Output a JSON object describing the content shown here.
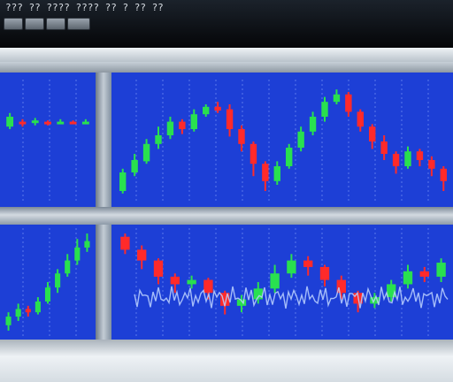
{
  "window": {
    "title": "??? ?? ???? ???? ?? ? ?? ??"
  },
  "toolbar": {
    "buttons": [
      {
        "icon": "button-icon"
      },
      {
        "icon": "button-icon"
      },
      {
        "icon": "button-icon"
      },
      {
        "icon": "button-icon"
      }
    ]
  },
  "theme": {
    "chart_bg": "#1d3fd6",
    "grid": "#8fa7ff",
    "bull": "#29e04f",
    "bear": "#ff2a2a",
    "noise": "#bcd2ff"
  },
  "chart_data": [
    {
      "type": "candlestick",
      "panel": "top-left",
      "series": [
        {
          "candles": [
            {
              "o": 0.62,
              "c": 0.7,
              "h": 0.73,
              "l": 0.6
            },
            {
              "o": 0.66,
              "c": 0.64,
              "h": 0.68,
              "l": 0.62
            },
            {
              "o": 0.65,
              "c": 0.67,
              "h": 0.69,
              "l": 0.63
            },
            {
              "o": 0.66,
              "c": 0.65,
              "h": 0.67,
              "l": 0.63
            },
            {
              "o": 0.65,
              "c": 0.66,
              "h": 0.68,
              "l": 0.64
            },
            {
              "o": 0.66,
              "c": 0.65,
              "h": 0.67,
              "l": 0.64
            },
            {
              "o": 0.65,
              "c": 0.66,
              "h": 0.68,
              "l": 0.64
            }
          ]
        }
      ]
    },
    {
      "type": "candlestick",
      "panel": "top-right",
      "series": [
        {
          "candles": [
            {
              "o": 0.1,
              "c": 0.25,
              "h": 0.28,
              "l": 0.08
            },
            {
              "o": 0.25,
              "c": 0.35,
              "h": 0.4,
              "l": 0.22
            },
            {
              "o": 0.34,
              "c": 0.48,
              "h": 0.52,
              "l": 0.32
            },
            {
              "o": 0.48,
              "c": 0.55,
              "h": 0.62,
              "l": 0.44
            },
            {
              "o": 0.55,
              "c": 0.66,
              "h": 0.7,
              "l": 0.52
            },
            {
              "o": 0.66,
              "c": 0.6,
              "h": 0.68,
              "l": 0.56
            },
            {
              "o": 0.6,
              "c": 0.72,
              "h": 0.76,
              "l": 0.58
            },
            {
              "o": 0.72,
              "c": 0.78,
              "h": 0.8,
              "l": 0.7
            },
            {
              "o": 0.78,
              "c": 0.75,
              "h": 0.82,
              "l": 0.73
            },
            {
              "o": 0.76,
              "c": 0.6,
              "h": 0.8,
              "l": 0.54
            },
            {
              "o": 0.6,
              "c": 0.48,
              "h": 0.63,
              "l": 0.42
            },
            {
              "o": 0.48,
              "c": 0.32,
              "h": 0.5,
              "l": 0.22
            },
            {
              "o": 0.32,
              "c": 0.18,
              "h": 0.34,
              "l": 0.1
            },
            {
              "o": 0.18,
              "c": 0.3,
              "h": 0.34,
              "l": 0.15
            },
            {
              "o": 0.3,
              "c": 0.45,
              "h": 0.48,
              "l": 0.28
            },
            {
              "o": 0.45,
              "c": 0.58,
              "h": 0.62,
              "l": 0.42
            },
            {
              "o": 0.58,
              "c": 0.7,
              "h": 0.74,
              "l": 0.55
            },
            {
              "o": 0.7,
              "c": 0.82,
              "h": 0.86,
              "l": 0.66
            },
            {
              "o": 0.82,
              "c": 0.88,
              "h": 0.92,
              "l": 0.8
            },
            {
              "o": 0.88,
              "c": 0.74,
              "h": 0.9,
              "l": 0.7
            },
            {
              "o": 0.74,
              "c": 0.62,
              "h": 0.76,
              "l": 0.58
            },
            {
              "o": 0.62,
              "c": 0.5,
              "h": 0.64,
              "l": 0.44
            },
            {
              "o": 0.5,
              "c": 0.4,
              "h": 0.55,
              "l": 0.35
            },
            {
              "o": 0.4,
              "c": 0.3,
              "h": 0.42,
              "l": 0.24
            },
            {
              "o": 0.3,
              "c": 0.42,
              "h": 0.46,
              "l": 0.28
            },
            {
              "o": 0.42,
              "c": 0.35,
              "h": 0.44,
              "l": 0.3
            },
            {
              "o": 0.35,
              "c": 0.28,
              "h": 0.38,
              "l": 0.22
            },
            {
              "o": 0.28,
              "c": 0.18,
              "h": 0.3,
              "l": 0.1
            }
          ]
        }
      ]
    },
    {
      "type": "candlestick",
      "panel": "bottom-left",
      "series": [
        {
          "candles": [
            {
              "o": 0.1,
              "c": 0.18,
              "h": 0.22,
              "l": 0.05
            },
            {
              "o": 0.18,
              "c": 0.25,
              "h": 0.3,
              "l": 0.14
            },
            {
              "o": 0.25,
              "c": 0.22,
              "h": 0.28,
              "l": 0.18
            },
            {
              "o": 0.22,
              "c": 0.32,
              "h": 0.36,
              "l": 0.2
            },
            {
              "o": 0.32,
              "c": 0.45,
              "h": 0.5,
              "l": 0.3
            },
            {
              "o": 0.45,
              "c": 0.58,
              "h": 0.62,
              "l": 0.4
            },
            {
              "o": 0.58,
              "c": 0.7,
              "h": 0.76,
              "l": 0.55
            },
            {
              "o": 0.7,
              "c": 0.82,
              "h": 0.9,
              "l": 0.66
            },
            {
              "o": 0.82,
              "c": 0.88,
              "h": 0.95,
              "l": 0.78
            }
          ]
        }
      ]
    },
    {
      "type": "candlestick",
      "panel": "bottom-right",
      "series": [
        {
          "candles": [
            {
              "o": 0.92,
              "c": 0.8,
              "h": 0.95,
              "l": 0.76
            },
            {
              "o": 0.8,
              "c": 0.7,
              "h": 0.84,
              "l": 0.62
            },
            {
              "o": 0.7,
              "c": 0.55,
              "h": 0.72,
              "l": 0.48
            },
            {
              "o": 0.55,
              "c": 0.48,
              "h": 0.58,
              "l": 0.4
            },
            {
              "o": 0.48,
              "c": 0.52,
              "h": 0.56,
              "l": 0.44
            },
            {
              "o": 0.52,
              "c": 0.4,
              "h": 0.54,
              "l": 0.34
            },
            {
              "o": 0.4,
              "c": 0.28,
              "h": 0.42,
              "l": 0.2
            },
            {
              "o": 0.28,
              "c": 0.34,
              "h": 0.38,
              "l": 0.22
            },
            {
              "o": 0.34,
              "c": 0.44,
              "h": 0.5,
              "l": 0.3
            },
            {
              "o": 0.44,
              "c": 0.58,
              "h": 0.66,
              "l": 0.4
            },
            {
              "o": 0.58,
              "c": 0.7,
              "h": 0.76,
              "l": 0.54
            },
            {
              "o": 0.7,
              "c": 0.64,
              "h": 0.74,
              "l": 0.56
            },
            {
              "o": 0.64,
              "c": 0.52,
              "h": 0.66,
              "l": 0.46
            },
            {
              "o": 0.52,
              "c": 0.4,
              "h": 0.56,
              "l": 0.34
            },
            {
              "o": 0.4,
              "c": 0.3,
              "h": 0.42,
              "l": 0.22
            },
            {
              "o": 0.3,
              "c": 0.36,
              "h": 0.4,
              "l": 0.26
            },
            {
              "o": 0.36,
              "c": 0.48,
              "h": 0.52,
              "l": 0.32
            },
            {
              "o": 0.48,
              "c": 0.6,
              "h": 0.66,
              "l": 0.44
            },
            {
              "o": 0.6,
              "c": 0.55,
              "h": 0.64,
              "l": 0.5
            },
            {
              "o": 0.55,
              "c": 0.68,
              "h": 0.72,
              "l": 0.5
            }
          ]
        }
      ]
    }
  ]
}
